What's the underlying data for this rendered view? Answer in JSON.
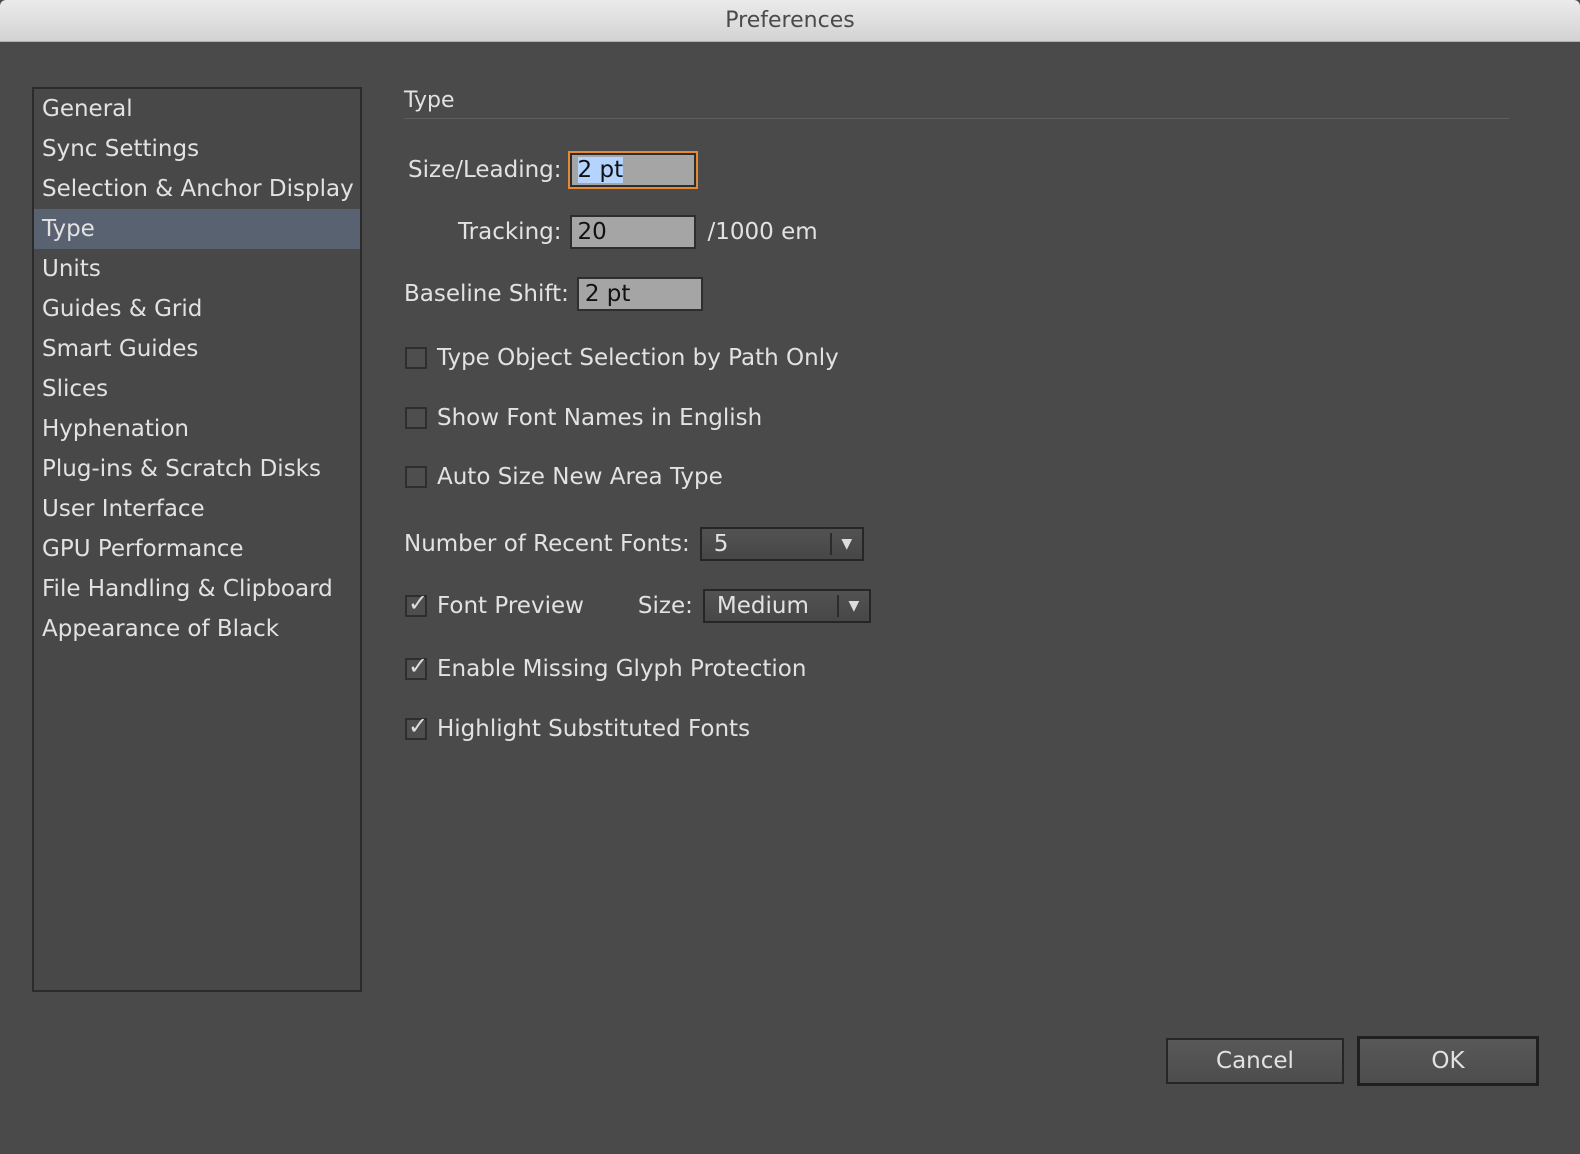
{
  "window": {
    "title": "Preferences"
  },
  "sidebar": {
    "items": [
      {
        "label": "General",
        "selected": false
      },
      {
        "label": "Sync Settings",
        "selected": false
      },
      {
        "label": "Selection & Anchor Display",
        "selected": false
      },
      {
        "label": "Type",
        "selected": true
      },
      {
        "label": "Units",
        "selected": false
      },
      {
        "label": "Guides & Grid",
        "selected": false
      },
      {
        "label": "Smart Guides",
        "selected": false
      },
      {
        "label": "Slices",
        "selected": false
      },
      {
        "label": "Hyphenation",
        "selected": false
      },
      {
        "label": "Plug-ins & Scratch Disks",
        "selected": false
      },
      {
        "label": "User Interface",
        "selected": false
      },
      {
        "label": "GPU Performance",
        "selected": false
      },
      {
        "label": "File Handling & Clipboard",
        "selected": false
      },
      {
        "label": "Appearance of Black",
        "selected": false
      }
    ]
  },
  "panel": {
    "title": "Type",
    "size_leading": {
      "label": "Size/Leading:",
      "value": "2 pt"
    },
    "tracking": {
      "label": "Tracking:",
      "value": "20",
      "unit": "/1000 em"
    },
    "baseline_shift": {
      "label": "Baseline Shift:",
      "value": "2 pt"
    },
    "type_object_selection": {
      "label": "Type Object Selection by Path Only",
      "checked": false
    },
    "show_font_names_english": {
      "label": "Show Font Names in English",
      "checked": false
    },
    "auto_size_area_type": {
      "label": "Auto Size New Area Type",
      "checked": false
    },
    "recent_fonts": {
      "label": "Number of Recent Fonts:",
      "value": "5"
    },
    "font_preview": {
      "label": "Font Preview",
      "checked": true,
      "size_label": "Size:",
      "size_value": "Medium"
    },
    "missing_glyph": {
      "label": "Enable Missing Glyph Protection",
      "checked": true
    },
    "highlight_substituted": {
      "label": "Highlight Substituted Fonts",
      "checked": true
    }
  },
  "buttons": {
    "cancel": "Cancel",
    "ok": "OK"
  },
  "colors": {
    "background": "#4a4a4a",
    "selection": "#596271",
    "focus": "#e48a37"
  }
}
